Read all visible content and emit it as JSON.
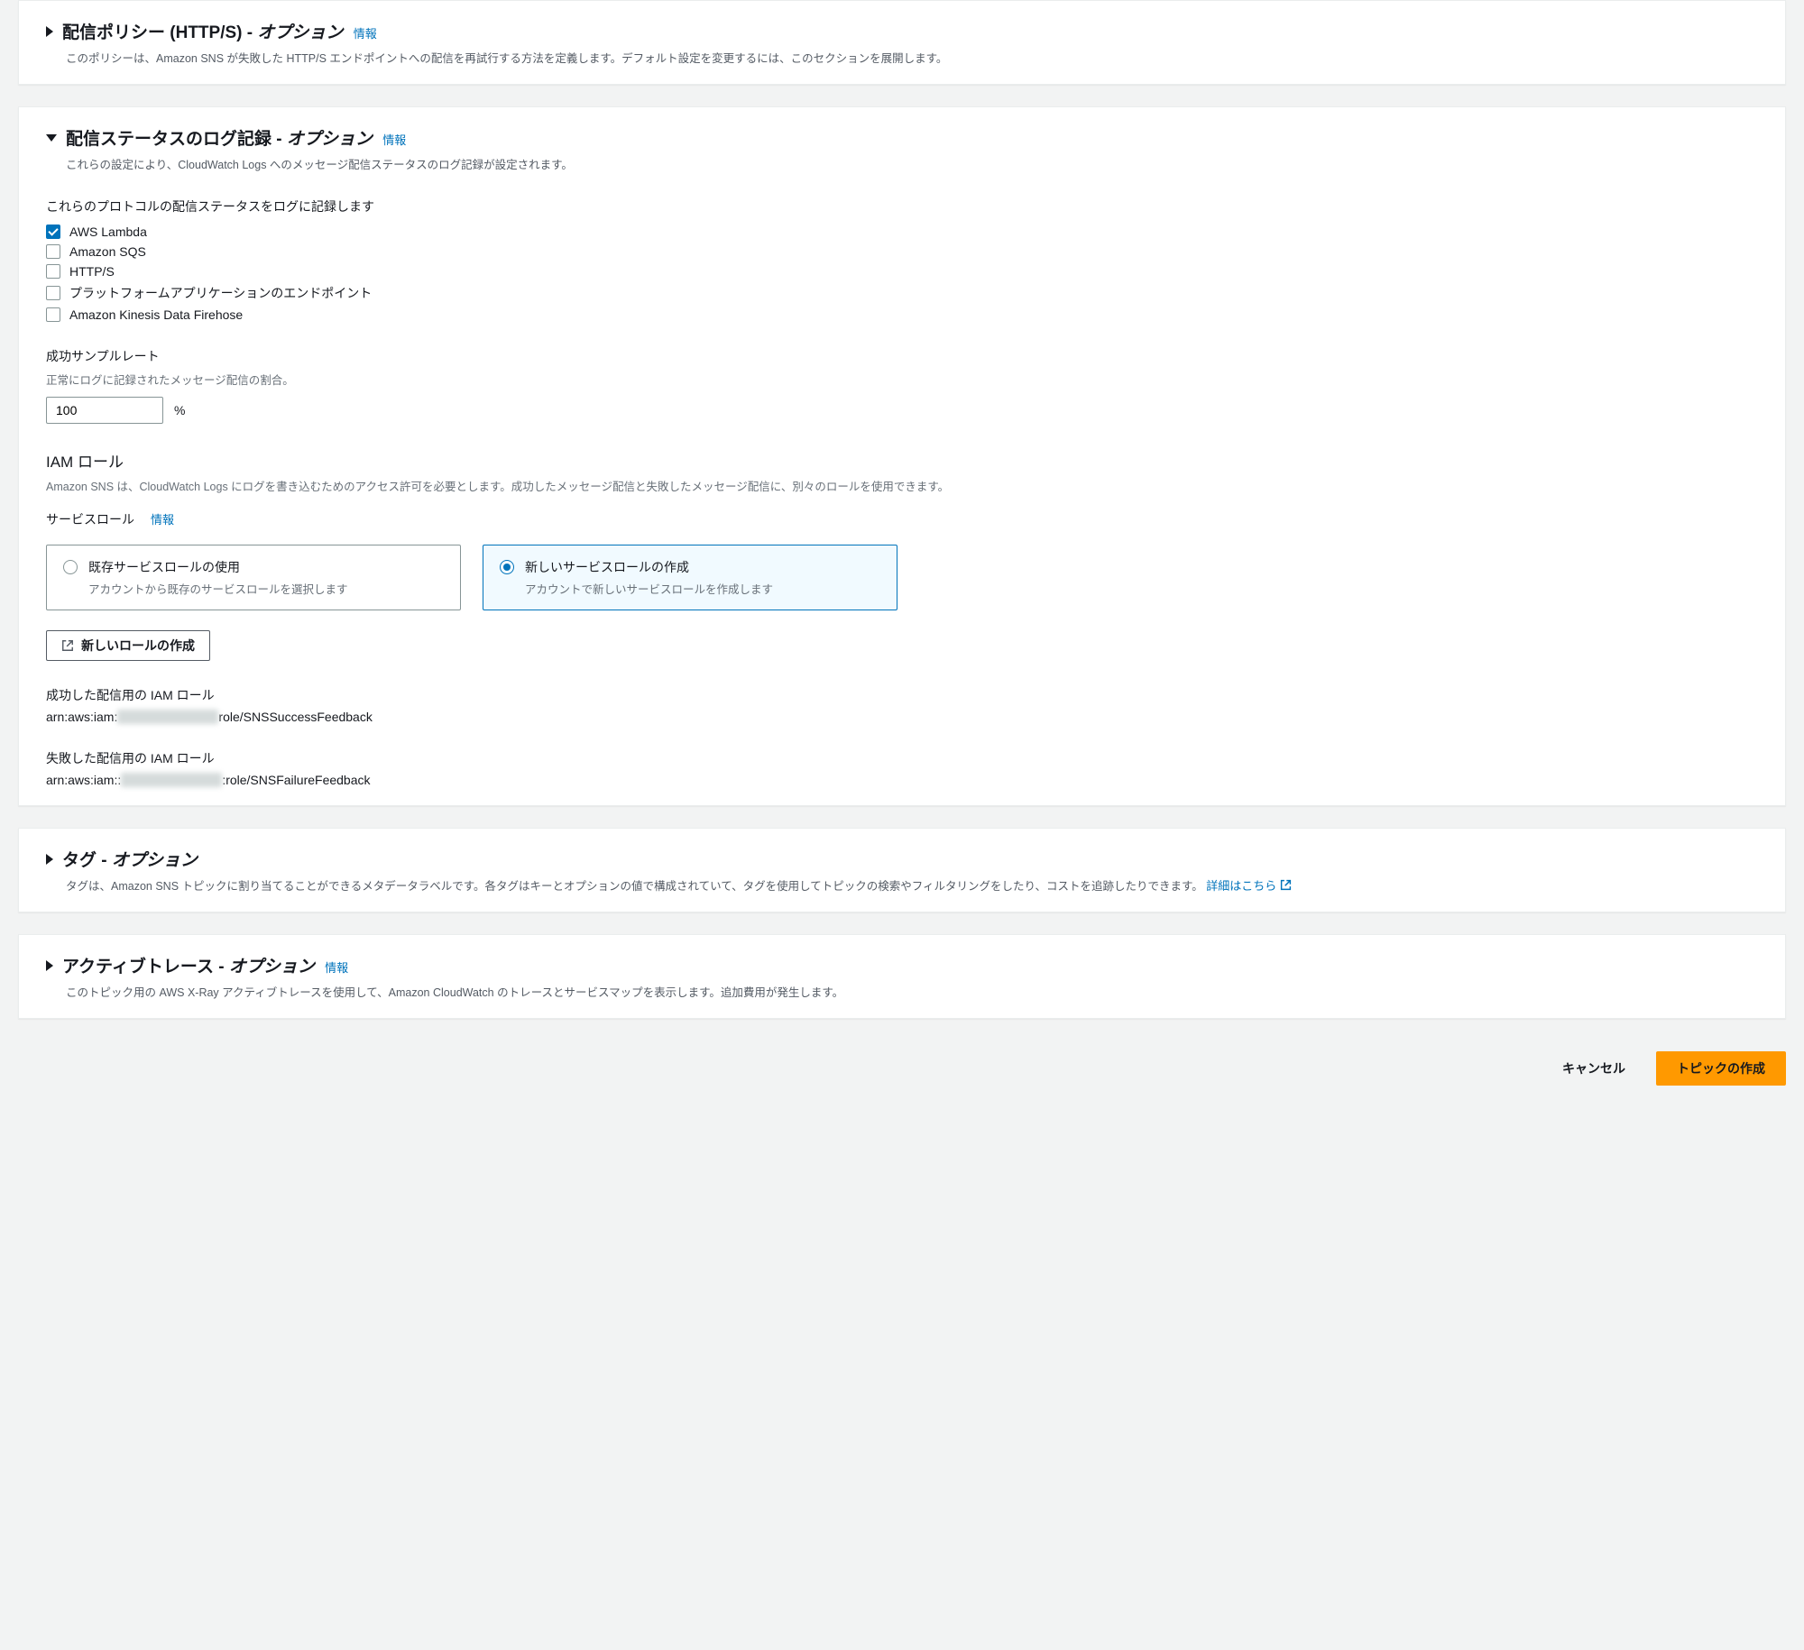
{
  "info_label": "情報",
  "sections": {
    "delivery_policy": {
      "title": "配信ポリシー (HTTP/S) - ",
      "optional": "オプション",
      "description": "このポリシーは、Amazon SNS が失敗した HTTP/S エンドポイントへの配信を再試行する方法を定義します。デフォルト設定を変更するには、このセクションを展開します。"
    },
    "delivery_status": {
      "title": "配信ステータスのログ記録 - ",
      "optional": "オプション",
      "description": "これらの設定により、CloudWatch Logs へのメッセージ配信ステータスのログ記録が設定されます。",
      "protocols_label": "これらのプロトコルの配信ステータスをログに記録します",
      "protocols": [
        {
          "label": "AWS Lambda",
          "checked": true
        },
        {
          "label": "Amazon SQS",
          "checked": false
        },
        {
          "label": "HTTP/S",
          "checked": false
        },
        {
          "label": "プラットフォームアプリケーションのエンドポイント",
          "checked": false
        },
        {
          "label": "Amazon Kinesis Data Firehose",
          "checked": false
        }
      ],
      "sample_rate": {
        "label": "成功サンプルレート",
        "hint": "正常にログに記録されたメッセージ配信の割合。",
        "value": "100",
        "unit": "%"
      },
      "iam": {
        "heading": "IAM ロール",
        "description": "Amazon SNS は、CloudWatch Logs にログを書き込むためのアクセス許可を必要とします。成功したメッセージ配信と失敗したメッセージ配信に、別々のロールを使用できます。",
        "service_role_label": "サービスロール",
        "options": {
          "existing": {
            "title": "既存サービスロールの使用",
            "desc": "アカウントから既存のサービスロールを選択します"
          },
          "create": {
            "title": "新しいサービスロールの作成",
            "desc": "アカウントで新しいサービスロールを作成します"
          }
        },
        "create_role_button": "新しいロールの作成",
        "success_role": {
          "label": "成功した配信用の IAM ロール",
          "prefix": "arn:aws:iam:",
          "hidden": "XXXXXXXXXXXX",
          "suffix": "role/SNSSuccessFeedback"
        },
        "failure_role": {
          "label": "失敗した配信用の IAM ロール",
          "prefix": "arn:aws:iam::",
          "hidden": "XXXXXXXXXXXX",
          "suffix": ":role/SNSFailureFeedback"
        }
      }
    },
    "tags": {
      "title": "タグ - ",
      "optional": "オプション",
      "description": "タグは、Amazon SNS トピックに割り当てることができるメタデータラベルです。各タグはキーとオプションの値で構成されていて、タグを使用してトピックの検索やフィルタリングをしたり、コストを追跡したりできます。",
      "learn_more": "詳細はこちら"
    },
    "active_tracing": {
      "title": "アクティブトレース - ",
      "optional": "オプション",
      "description": "このトピック用の AWS X-Ray アクティブトレースを使用して、Amazon CloudWatch のトレースとサービスマップを表示します。追加費用が発生します。"
    }
  },
  "footer": {
    "cancel": "キャンセル",
    "submit": "トピックの作成"
  }
}
